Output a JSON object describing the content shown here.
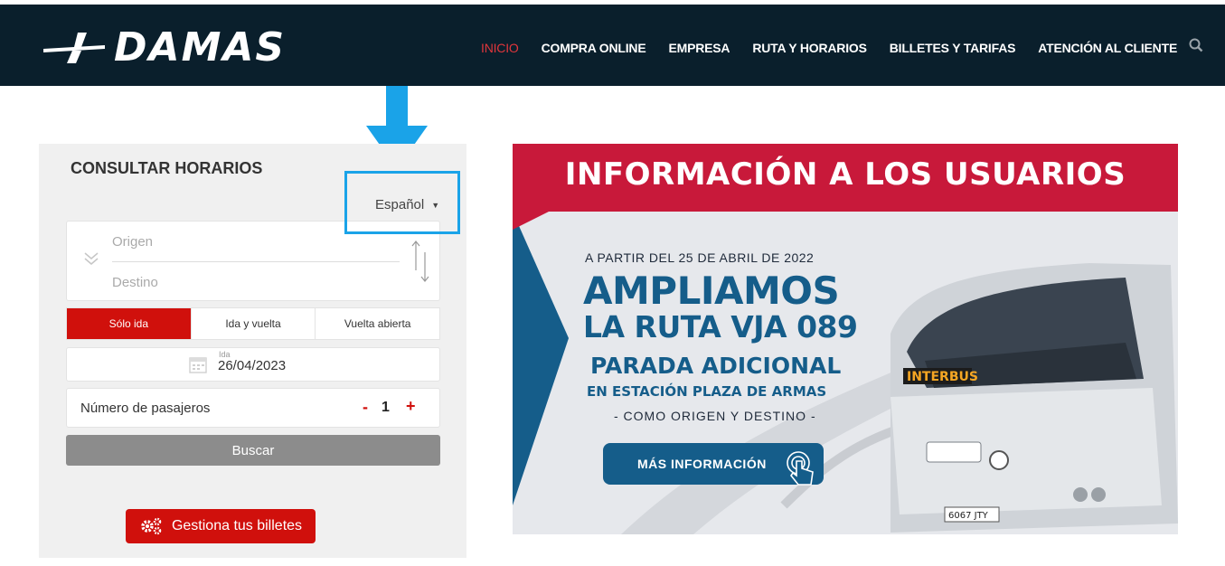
{
  "header": {
    "logo_text": "DAMAS",
    "nav": [
      {
        "label": "INICIO",
        "active": true
      },
      {
        "label": "COMPRA ONLINE"
      },
      {
        "label": "EMPRESA"
      },
      {
        "label": "RUTA Y HORARIOS"
      },
      {
        "label": "BILLETES Y TARIFAS"
      },
      {
        "label": "ATENCIÓN AL CLIENTE"
      }
    ],
    "search_icon": "search-icon"
  },
  "form": {
    "title": "CONSULTAR HORARIOS",
    "language": "Español",
    "origin_placeholder": "Origen",
    "destination_placeholder": "Destino",
    "trip_types": [
      "Sólo ida",
      "Ida y vuelta",
      "Vuelta abierta"
    ],
    "selected_trip_type": "Sólo ida",
    "date_label": "Ida",
    "date_value": "26/04/2023",
    "passengers_label": "Número de pasajeros",
    "passengers_minus": "-",
    "passengers_value": "1",
    "passengers_plus": "+",
    "search_button": "Buscar",
    "manage_button": "Gestiona tus billetes"
  },
  "banner": {
    "title": "INFORMACIÓN A LOS USUARIOS",
    "from_date": "A PARTIR DEL 25 DE ABRIL DE 2022",
    "headline1": "AMPLIAMOS",
    "headline2": "LA RUTA VJA 089",
    "sub1": "PARADA ADICIONAL",
    "sub2": "EN ESTACIÓN PLAZA DE ARMAS",
    "sub3": "- COMO ORIGEN Y DESTINO -",
    "cta": "MÁS INFORMACIÓN",
    "bus_sign": "INTERBUS",
    "plate": "6067 JTY"
  },
  "colors": {
    "header_bg": "#0a1f2c",
    "brand_red": "#d0100c",
    "nav_active": "#e0363c",
    "highlight_blue": "#1aa3e8",
    "banner_red": "#c8193a",
    "banner_blue": "#155d8a"
  }
}
